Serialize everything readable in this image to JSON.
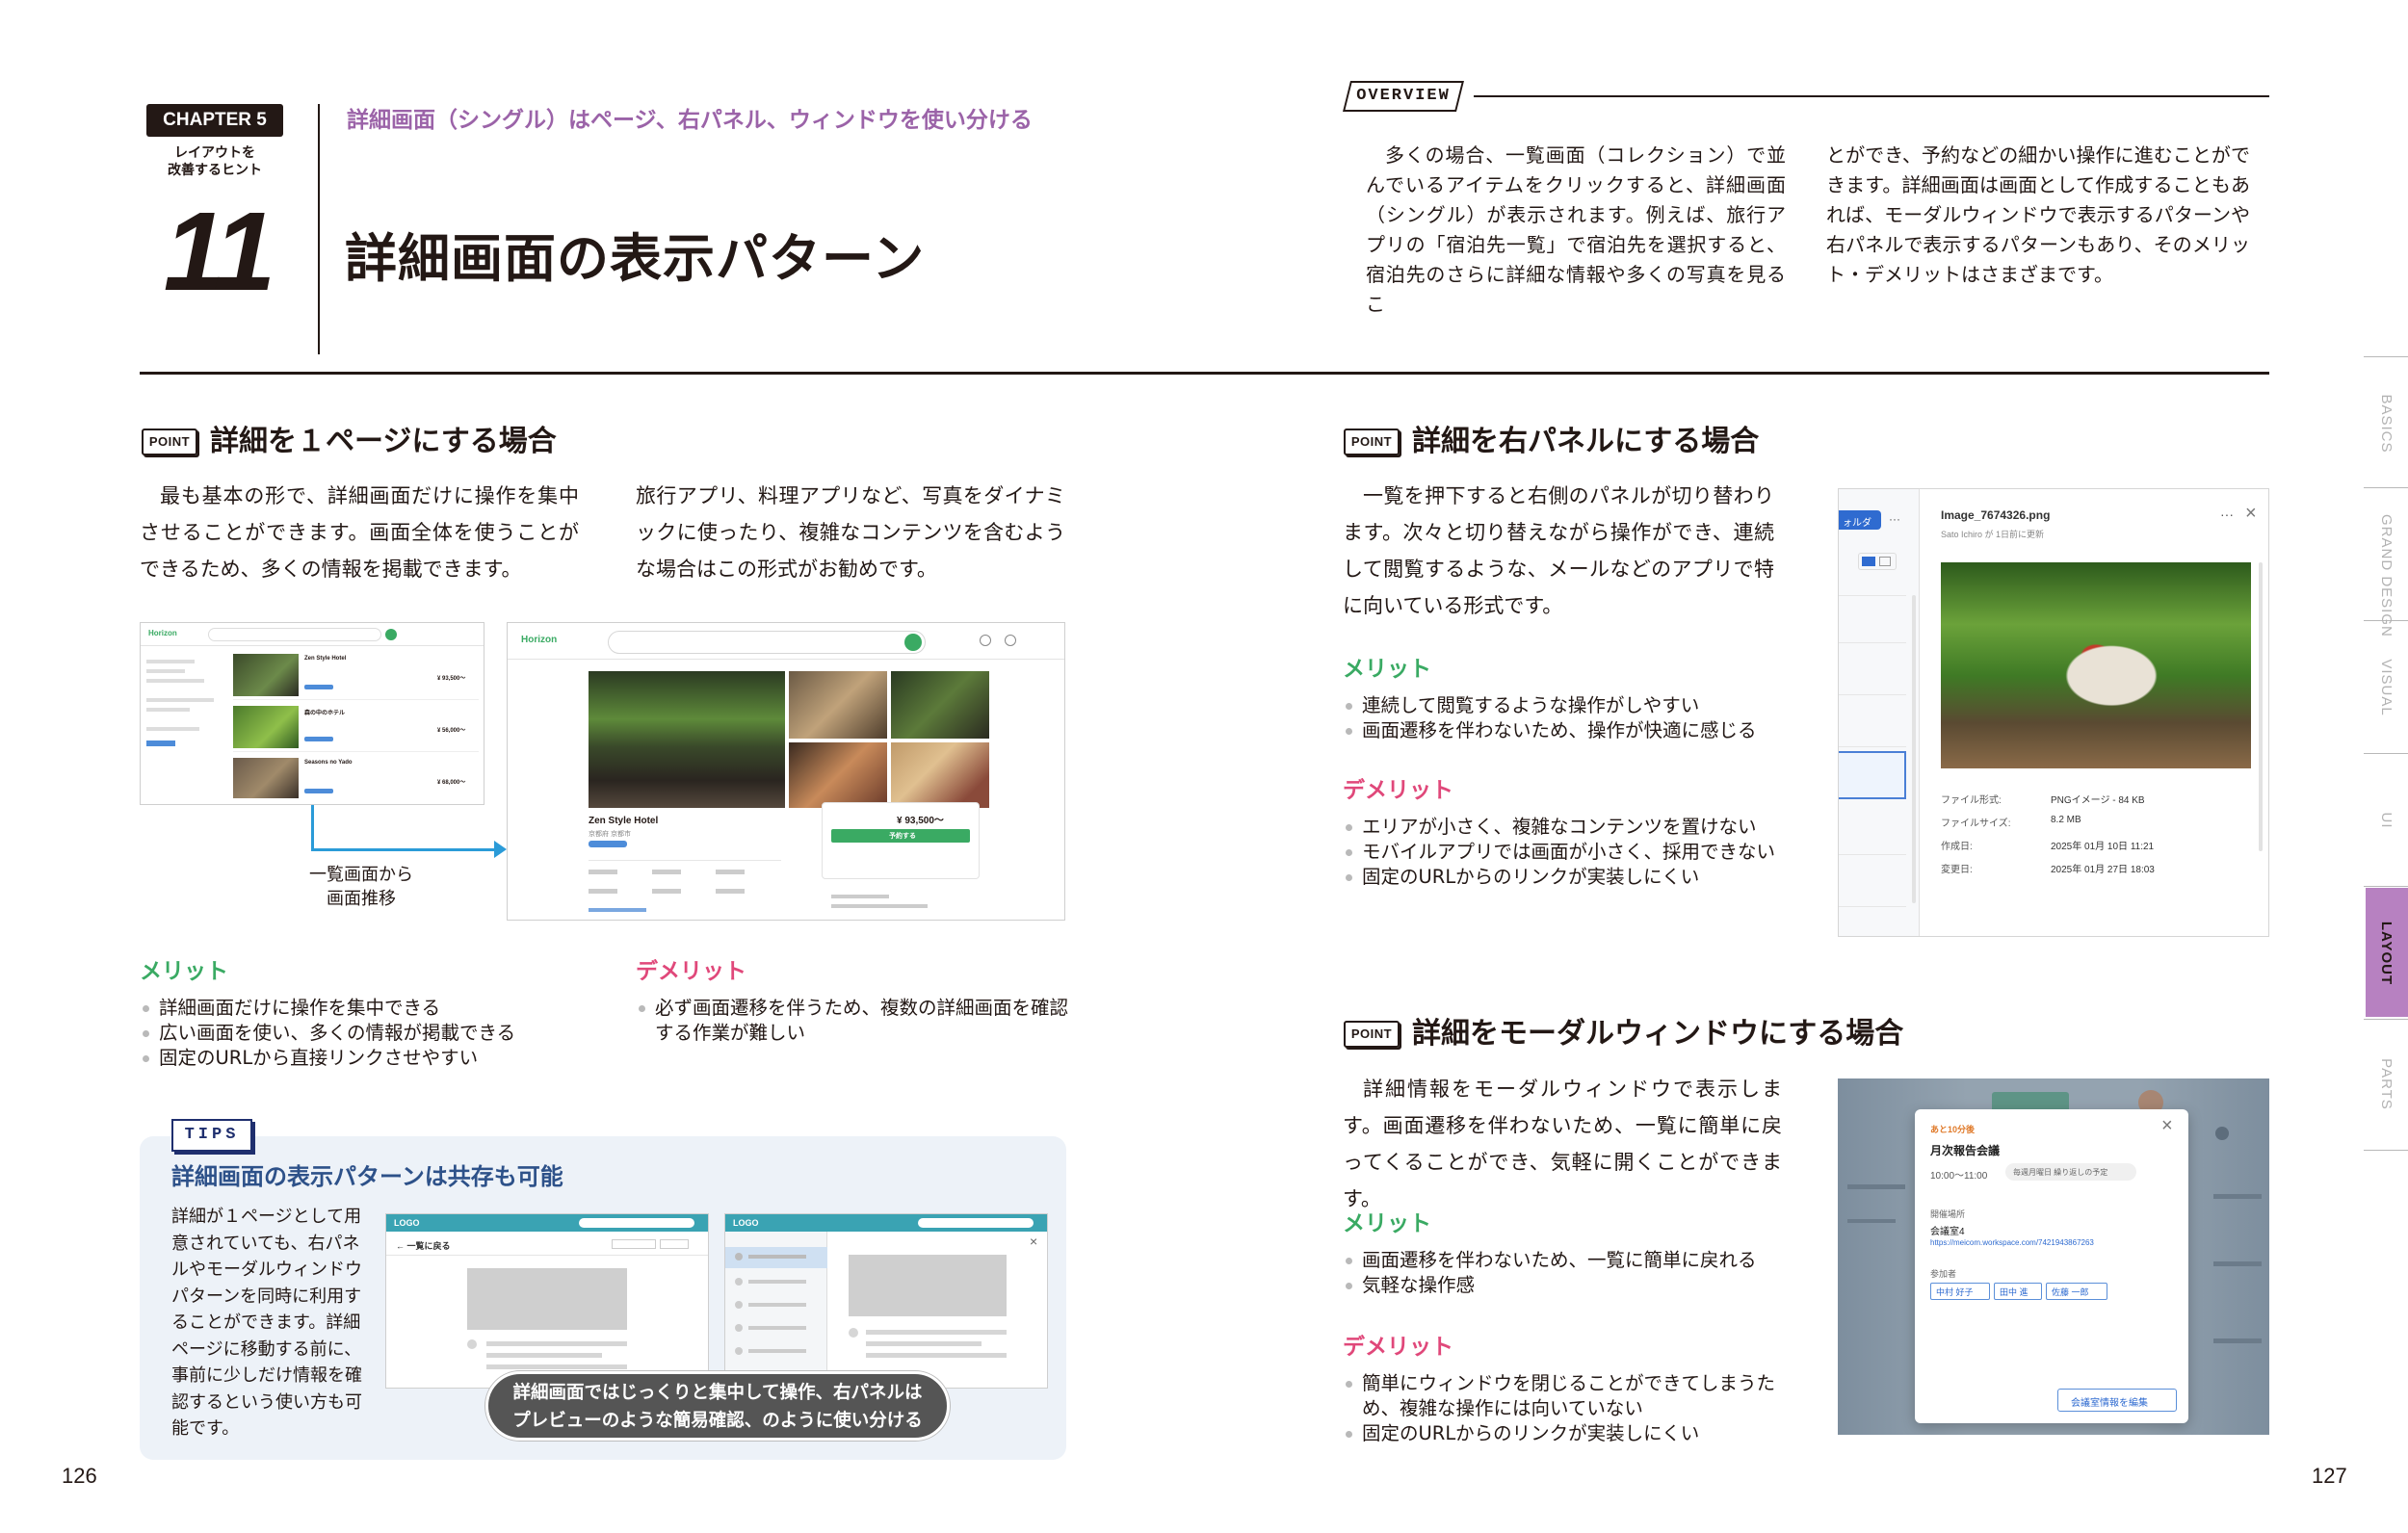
{
  "header": {
    "chapter_label": "CHAPTER 5",
    "chapter_subtitle": "レイアウトを\n改善するヒント",
    "chapter_number": "11",
    "subtitle": "詳細画面（シングル）はページ、右パネル、ウィンドウを使い分ける",
    "title": "詳細画面の表示パターン"
  },
  "overview": {
    "tag": "OVERVIEW",
    "col1": "多くの場合、一覧画面（コレクション）で並んでいるアイテムをクリックすると、詳細画面（シングル）が表示されます。例えば、旅行アプリの「宿泊先一覧」で宿泊先を選択すると、宿泊先のさらに詳細な情報や多くの写真を見るこ",
    "col2": "とができ、予約などの細かい操作に進むことができます。詳細画面は画面として作成することもあれば、モーダルウィンドウで表示するパターンや右パネルで表示するパターンもあり、そのメリット・デメリットはさまざまです。"
  },
  "index_tabs": [
    "BASICS",
    "GRAND DESIGN",
    "VISUAL",
    "UI",
    "LAYOUT",
    "PARTS"
  ],
  "section1": {
    "point_tag": "POINT",
    "title": "詳細を１ページにする場合",
    "body_left": "最も基本の形で、詳細画面だけに操作を集中させることができます。画面全体を使うことができるため、多くの情報を掲載できます。",
    "body_right": "旅行アプリ、料理アプリなど、写真をダイナミックに使ったり、複雑なコンテンツを含むような場合はこの形式がお勧めです。",
    "flow_caption": "一覧画面から\n画面推移",
    "merit_heading": "メリット",
    "merits": [
      "詳細画面だけに操作を集中できる",
      "広い画面を使い、多くの情報が掲載できる",
      "固定のURLから直接リンクさせやすい"
    ],
    "demerit_heading": "デメリット",
    "demerits": [
      "必ず画面遷移を伴うため、複数の詳細画面を確認する作業が難しい"
    ],
    "mock": {
      "brand": "Horizon",
      "hotel_name": "Zen Style Hotel",
      "hotel_loc": "京都府 京都市",
      "price": "¥ 93,500〜",
      "reserve": "予約する",
      "list_names": [
        "Zen Style Hotel",
        "森の中のホテル",
        "Seasons no Yado"
      ],
      "list_prices": [
        "¥ 93,500〜",
        "¥ 56,000〜",
        "¥ 68,000〜"
      ]
    }
  },
  "tips": {
    "tag": "TIPS",
    "title": "詳細画面の表示パターンは共存も可能",
    "body": "詳細が１ページとして用意されていても、右パネルやモーダルウィンドウパターンを同時に利用することができます。詳細ページに移動する前に、事前に少しだけ情報を確認するという使い方も可能です。",
    "logo": "LOGO",
    "back_label": "← 一覧に戻る",
    "callout": "詳細画面ではじっくりと集中して操作、右パネルは\nプレビューのような簡易確認、のように使い分ける"
  },
  "section2": {
    "point_tag": "POINT",
    "title": "詳細を右パネルにする場合",
    "body": "一覧を押下すると右側のパネルが切り替わります。次々と切り替えながら操作ができ、連続して閲覧するような、メールなどのアプリで特に向いている形式です。",
    "merit_heading": "メリット",
    "merits": [
      "連続して閲覧するような操作がしやすい",
      "画面遷移を伴わないため、操作が快適に感じる"
    ],
    "demerit_heading": "デメリット",
    "demerits": [
      "エリアが小さく、複雑なコンテンツを置けない",
      "モバイルアプリでは画面が小さく、採用できない",
      "固定のURLからのリンクが実装しにくい"
    ],
    "panel": {
      "folder_label": "ォルダ",
      "file_name": "Image_7674326.png",
      "meta": "Sato Ichiro が 1日前に更新",
      "rows": [
        {
          "k": "ファイル形式:",
          "v": "PNGイメージ - 84 KB"
        },
        {
          "k": "ファイルサイズ:",
          "v": "8.2 MB"
        },
        {
          "k": "作成日:",
          "v": "2025年 01月 10日 11:21"
        },
        {
          "k": "変更日:",
          "v": "2025年 01月 27日 18:03"
        }
      ]
    }
  },
  "section3": {
    "point_tag": "POINT",
    "title": "詳細をモーダルウィンドウにする場合",
    "body": "詳細情報をモーダルウィンドウで表示します。画面遷移を伴わないため、一覧に簡単に戻ってくることができ、気軽に開くことができます。",
    "merit_heading": "メリット",
    "merits": [
      "画面遷移を伴わないため、一覧に簡単に戻れる",
      "気軽な操作感"
    ],
    "demerit_heading": "デメリット",
    "demerits": [
      "簡単にウィンドウを閉じることができてしまうため、複雑な操作には向いていない",
      "固定のURLからのリンクが実装しにくい"
    ],
    "modal": {
      "badge": "あと10分後",
      "title": "月次報告会議",
      "time": "10:00〜11:00",
      "repeat": "毎週月曜日 繰り返しの予定",
      "place_label": "開催場所",
      "place": "会議室4",
      "link": "https://meicom.workspace.com/7421943867263",
      "attendees_label": "参加者",
      "attendees": [
        "中村 好子",
        "田中 進",
        "佐藤 一郎"
      ],
      "edit_button": "会議室情報を編集"
    }
  },
  "pages": {
    "left": "126",
    "right": "127"
  }
}
